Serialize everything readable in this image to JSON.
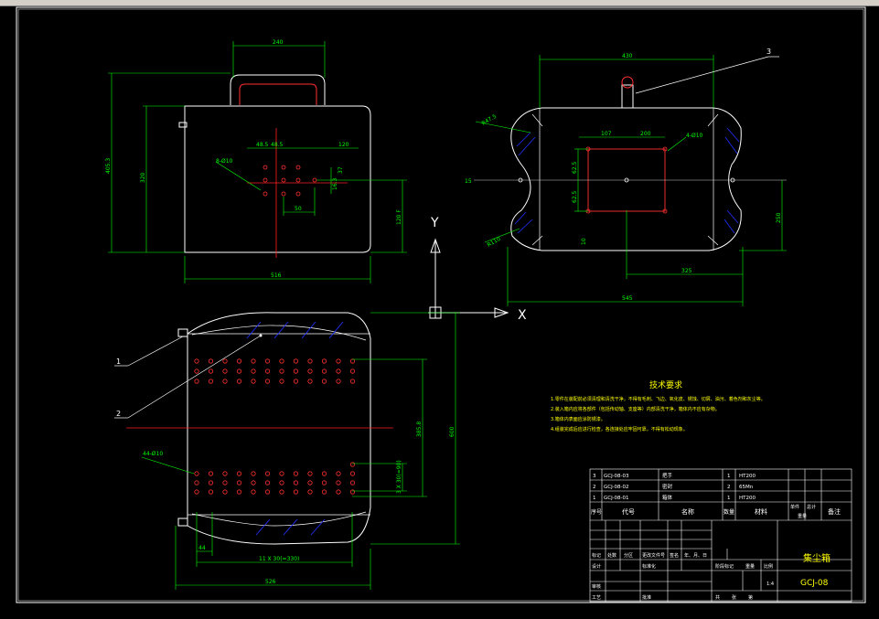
{
  "colors": {
    "background": "#000000",
    "outline": "#ffffff",
    "dimension": "#00ff00",
    "hole": "#ff3030",
    "centerline": "#ff2020",
    "hatch": "#2030ff",
    "leader": "#ffffff",
    "title_text": "#ffff00"
  },
  "top_view": {
    "dims": {
      "handle_width": "240",
      "left_height": "405.3",
      "inner_height": "320",
      "width_bottom": "516",
      "right_dim": "120",
      "right_vertical": "120 F",
      "hole_spacing_a": "48.5",
      "hole_spacing_b": "48.5",
      "hole_spacing_c": "50",
      "hole_diameter": "8-Ø10",
      "side_a": "16.3",
      "side_b": "37"
    }
  },
  "side_view": {
    "dims": {
      "overall_width": "430",
      "inner_width": "107",
      "inner_width2": "200",
      "height_right": "250",
      "bottom_width": "545",
      "right_offset": "325",
      "hole_label": "4-Ø10",
      "rad_label": "R47.5",
      "rad_label2": "R110",
      "left_label": "15",
      "inner_vertical_a": "62.5",
      "inner_vertical_b": "62.5",
      "inner_small": "10"
    },
    "balloon": "3"
  },
  "front_view": {
    "dims": {
      "height_right": "385.8",
      "overall_right": "600",
      "bottom_pitch": "11 X 30(=330)",
      "bottom_overall": "526",
      "small_left": "44",
      "hole_label": "44-Ø10",
      "small_vertical": "3 X 30(=90)"
    },
    "balloons": [
      "1",
      "2"
    ]
  },
  "axes": {
    "y_label": "Y",
    "x_label": "X"
  },
  "tech_req": {
    "title": "技术要求",
    "lines": [
      "1.零件在装配前必须清理和清洗干净，不得有毛刺、飞边、氧化皮、锈蚀、切屑、油污、着色剂和灰尘等。",
      "2.装入箱内应将各部件（包括传动轴、支座等）内部清洗干净，箱体内不应有杂物。",
      "3.箱体内表面应涂防锈漆。",
      "4.组装完成后应进行检查，各连接处应牢固可靠，不得有松动现象。"
    ]
  },
  "bom": {
    "rows": [
      {
        "seq": "3",
        "code": "GCJ-08-03",
        "name": "把手",
        "qty": "1",
        "material": "HT200"
      },
      {
        "seq": "2",
        "code": "GCJ-08-02",
        "name": "密封",
        "qty": "2",
        "material": "65Mn"
      },
      {
        "seq": "1",
        "code": "GCJ-08-01",
        "name": "箱体",
        "qty": "1",
        "material": "HT200"
      }
    ],
    "header": {
      "seq": "序号",
      "code": "代号",
      "name": "名称",
      "qty": "数量",
      "material": "材料",
      "unit_weight": "单件",
      "total_weight": "总计",
      "weight": "重量",
      "note": "备注"
    }
  },
  "title_block": {
    "drawing_name": "集尘箱",
    "drawing_code": "GCJ-08",
    "scale": "1:4",
    "marks": "标记",
    "count": "处数",
    "zone": "分区",
    "change_doc": "更改文件号",
    "sign": "签名",
    "date": "年、月、日",
    "design": "设计",
    "standard": "标准化",
    "review": "审核",
    "process": "工艺",
    "approve": "批准",
    "stage_mark": "阶段标记",
    "weight_lbl": "重量",
    "scale_lbl": "比例",
    "sheet_total": "共",
    "sheet_unit": "张",
    "sheet_no": "第"
  }
}
